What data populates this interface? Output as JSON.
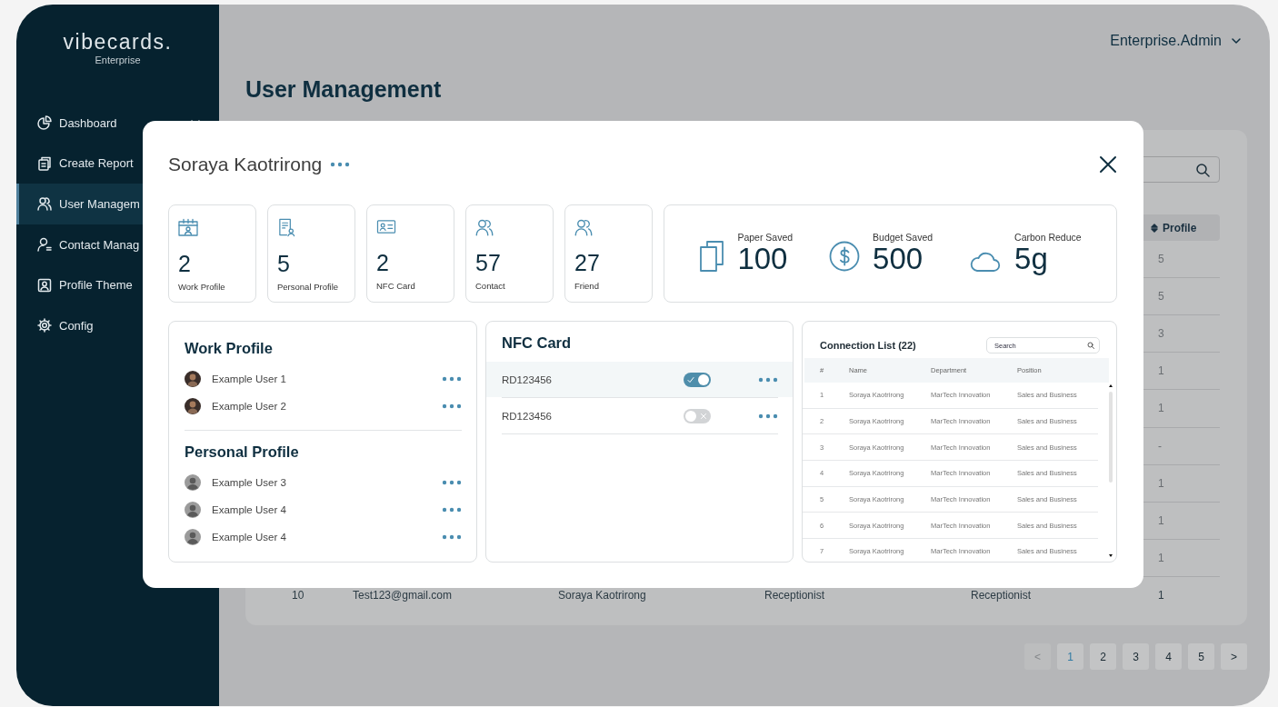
{
  "sidebar": {
    "logo": "vibecards.",
    "subtitle": "Enterprise",
    "items": [
      {
        "label": "Dashboard",
        "kind": "dropdown",
        "selected": false
      },
      {
        "label": "Create Report",
        "kind": "link",
        "selected": false
      },
      {
        "label": "User Managem",
        "kind": "link",
        "selected": true
      },
      {
        "label": "Contact Manag",
        "kind": "link",
        "selected": false
      },
      {
        "label": "Profile Theme",
        "kind": "link",
        "selected": false
      },
      {
        "label": "Config",
        "kind": "link",
        "selected": false
      }
    ]
  },
  "header": {
    "user": "Enterprise.Admin"
  },
  "page_title": "User Management",
  "table": {
    "header": {
      "profile": "Profile"
    },
    "rows": [
      {
        "profile": "5"
      },
      {
        "profile": "5"
      },
      {
        "profile": "3"
      },
      {
        "profile": "1"
      },
      {
        "profile": "1"
      },
      {
        "profile": "-"
      },
      {
        "profile": "1"
      },
      {
        "profile": "1"
      },
      {
        "profile": "1"
      },
      {
        "column_1": "10",
        "column_2": "Test123@gmail.com",
        "column_3": "Soraya Kaotrirong",
        "column_4": "Receptionist",
        "column_5": "Receptionist",
        "profile": "1"
      }
    ]
  },
  "pagination": [
    {
      "label": "<",
      "selected": false,
      "disabled": true
    },
    {
      "label": "1",
      "selected": true,
      "disabled": false
    },
    {
      "label": "2",
      "selected": false,
      "disabled": false
    },
    {
      "label": "3",
      "selected": false,
      "disabled": false
    },
    {
      "label": "4",
      "selected": false,
      "disabled": false
    },
    {
      "label": "5",
      "selected": false,
      "disabled": false
    },
    {
      "label": ">",
      "selected": false,
      "disabled": false
    }
  ],
  "modal": {
    "title": "Soraya Kaotrirong",
    "stats": [
      {
        "kind": "work_profile",
        "value": "2",
        "label": "Work Profile"
      },
      {
        "kind": "personal_profile",
        "value": "5",
        "label": "Personal Profile"
      },
      {
        "kind": "nfc_card",
        "value": "2",
        "label": "NFC Card"
      },
      {
        "kind": "contact",
        "value": "57",
        "label": "Contact"
      },
      {
        "kind": "friend",
        "value": "27",
        "label": "Friend"
      }
    ],
    "savings": [
      {
        "kind": "paper",
        "label": "Paper Saved",
        "value": "100"
      },
      {
        "kind": "budget",
        "label": "Budget Saved",
        "value": "500"
      },
      {
        "kind": "carbon",
        "label": "Carbon Reduce",
        "value": "5g"
      }
    ],
    "work_profile": {
      "title": "Work Profile",
      "users": [
        {
          "name": "Example User 1",
          "kind": "photo"
        },
        {
          "name": "Example User 2",
          "kind": "photo"
        }
      ]
    },
    "personal_profile": {
      "title": "Personal Profile",
      "users": [
        {
          "name": "Example User 3",
          "kind": "default"
        },
        {
          "name": "Example User 4",
          "kind": "default"
        },
        {
          "name": "Example User 4",
          "kind": "default"
        }
      ]
    },
    "nfc": {
      "title": "NFC Card",
      "cards": [
        {
          "id": "RD123456",
          "on": true,
          "selected": true
        },
        {
          "id": "RD123456",
          "on": false,
          "selected": false
        }
      ]
    },
    "connections": {
      "title": "Connection List (22)",
      "search_placeholder": "Search",
      "columns": [
        "#",
        "Name",
        "Department",
        "Position"
      ],
      "rows": [
        [
          "1",
          "Soraya Kaotrirong",
          "MarTech Innovation",
          "Sales and Business"
        ],
        [
          "2",
          "Soraya Kaotrirong",
          "MarTech Innovation",
          "Sales and Business"
        ],
        [
          "3",
          "Soraya Kaotrirong",
          "MarTech Innovation",
          "Sales and Business"
        ],
        [
          "4",
          "Soraya Kaotrirong",
          "MarTech Innovation",
          "Sales and Business"
        ],
        [
          "5",
          "Soraya Kaotrirong",
          "MarTech Innovation",
          "Sales and Business"
        ],
        [
          "6",
          "Soraya Kaotrirong",
          "MarTech Innovation",
          "Sales and Business"
        ],
        [
          "7",
          "Soraya Kaotrirong",
          "MarTech Innovation",
          "Sales and Business"
        ]
      ]
    }
  }
}
